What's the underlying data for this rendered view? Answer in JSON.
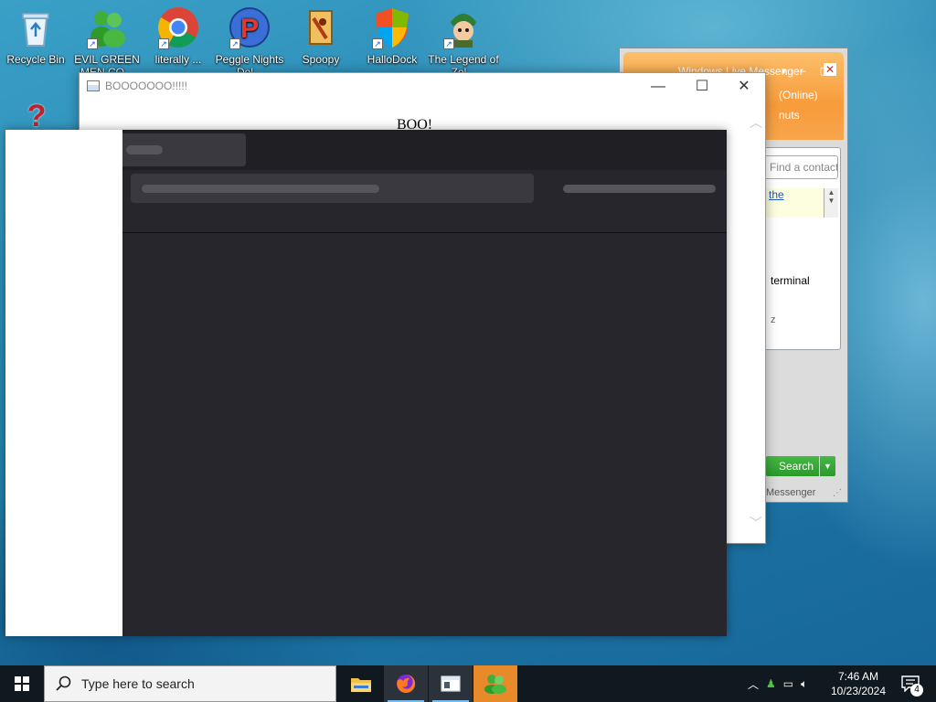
{
  "desktop_icons": [
    {
      "label": "Recycle Bin",
      "icon": "recycle-bin-icon"
    },
    {
      "label": "EVIL GREEN MEN CO...",
      "icon": "green-men-icon"
    },
    {
      "label": "literally ...",
      "icon": "chrome-icon"
    },
    {
      "label": "Peggle Nights Del...",
      "icon": "peggle-icon"
    },
    {
      "label": "Spoopy",
      "icon": "spoopy-icon"
    },
    {
      "label": "HalloDock",
      "icon": "shield-icon"
    },
    {
      "label": "The Legend of Zel...",
      "icon": "zelda-icon"
    }
  ],
  "help_badge": "?",
  "messenger": {
    "title": "Windows Live Messenger",
    "status": "(Online)",
    "personal_message": "nuts",
    "search_placeholder": "Find a contact or number",
    "news_link": "the",
    "contact_1": "terminal",
    "contact_2": "z",
    "search_button": "Search",
    "footer": "Messenger"
  },
  "boo_window": {
    "title": "BOOOOOOO!!!!!",
    "heading": "BOO!",
    "minimize_glyph": "—",
    "maximize_glyph": "☐",
    "close_glyph": "✕"
  },
  "taskbar": {
    "search_placeholder": "Type here to search",
    "apps": [
      {
        "name": "file-explorer",
        "icon": "folder-icon"
      },
      {
        "name": "firefox",
        "icon": "firefox-icon"
      },
      {
        "name": "boo-app",
        "icon": "window-icon"
      },
      {
        "name": "messenger",
        "icon": "messenger-icon"
      }
    ],
    "time": "7:46 AM",
    "date": "10/23/2024",
    "notification_count": "4"
  },
  "colors": {
    "taskbar": "#101820",
    "dark_panel": "#27262c",
    "messenger_orange": "#f89b3b"
  }
}
